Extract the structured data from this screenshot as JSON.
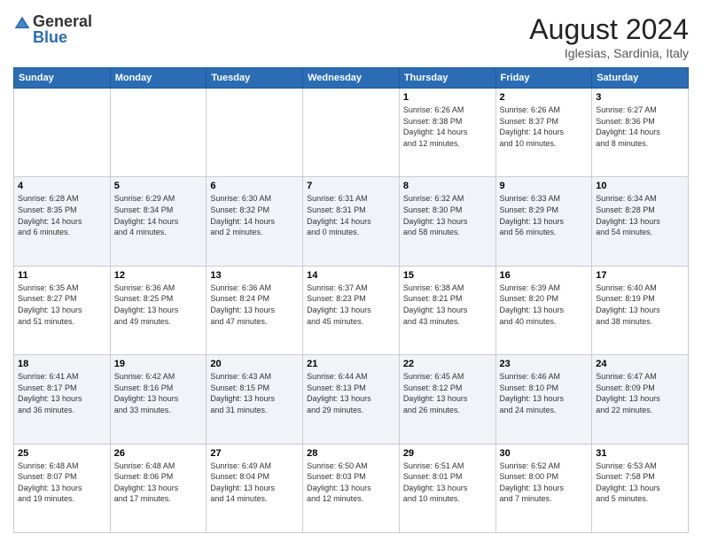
{
  "logo": {
    "general": "General",
    "blue": "Blue"
  },
  "header": {
    "month": "August 2024",
    "location": "Iglesias, Sardinia, Italy"
  },
  "weekdays": [
    "Sunday",
    "Monday",
    "Tuesday",
    "Wednesday",
    "Thursday",
    "Friday",
    "Saturday"
  ],
  "weeks": [
    [
      {
        "day": "",
        "info": ""
      },
      {
        "day": "",
        "info": ""
      },
      {
        "day": "",
        "info": ""
      },
      {
        "day": "",
        "info": ""
      },
      {
        "day": "1",
        "info": "Sunrise: 6:26 AM\nSunset: 8:38 PM\nDaylight: 14 hours\nand 12 minutes."
      },
      {
        "day": "2",
        "info": "Sunrise: 6:26 AM\nSunset: 8:37 PM\nDaylight: 14 hours\nand 10 minutes."
      },
      {
        "day": "3",
        "info": "Sunrise: 6:27 AM\nSunset: 8:36 PM\nDaylight: 14 hours\nand 8 minutes."
      }
    ],
    [
      {
        "day": "4",
        "info": "Sunrise: 6:28 AM\nSunset: 8:35 PM\nDaylight: 14 hours\nand 6 minutes."
      },
      {
        "day": "5",
        "info": "Sunrise: 6:29 AM\nSunset: 8:34 PM\nDaylight: 14 hours\nand 4 minutes."
      },
      {
        "day": "6",
        "info": "Sunrise: 6:30 AM\nSunset: 8:32 PM\nDaylight: 14 hours\nand 2 minutes."
      },
      {
        "day": "7",
        "info": "Sunrise: 6:31 AM\nSunset: 8:31 PM\nDaylight: 14 hours\nand 0 minutes."
      },
      {
        "day": "8",
        "info": "Sunrise: 6:32 AM\nSunset: 8:30 PM\nDaylight: 13 hours\nand 58 minutes."
      },
      {
        "day": "9",
        "info": "Sunrise: 6:33 AM\nSunset: 8:29 PM\nDaylight: 13 hours\nand 56 minutes."
      },
      {
        "day": "10",
        "info": "Sunrise: 6:34 AM\nSunset: 8:28 PM\nDaylight: 13 hours\nand 54 minutes."
      }
    ],
    [
      {
        "day": "11",
        "info": "Sunrise: 6:35 AM\nSunset: 8:27 PM\nDaylight: 13 hours\nand 51 minutes."
      },
      {
        "day": "12",
        "info": "Sunrise: 6:36 AM\nSunset: 8:25 PM\nDaylight: 13 hours\nand 49 minutes."
      },
      {
        "day": "13",
        "info": "Sunrise: 6:36 AM\nSunset: 8:24 PM\nDaylight: 13 hours\nand 47 minutes."
      },
      {
        "day": "14",
        "info": "Sunrise: 6:37 AM\nSunset: 8:23 PM\nDaylight: 13 hours\nand 45 minutes."
      },
      {
        "day": "15",
        "info": "Sunrise: 6:38 AM\nSunset: 8:21 PM\nDaylight: 13 hours\nand 43 minutes."
      },
      {
        "day": "16",
        "info": "Sunrise: 6:39 AM\nSunset: 8:20 PM\nDaylight: 13 hours\nand 40 minutes."
      },
      {
        "day": "17",
        "info": "Sunrise: 6:40 AM\nSunset: 8:19 PM\nDaylight: 13 hours\nand 38 minutes."
      }
    ],
    [
      {
        "day": "18",
        "info": "Sunrise: 6:41 AM\nSunset: 8:17 PM\nDaylight: 13 hours\nand 36 minutes."
      },
      {
        "day": "19",
        "info": "Sunrise: 6:42 AM\nSunset: 8:16 PM\nDaylight: 13 hours\nand 33 minutes."
      },
      {
        "day": "20",
        "info": "Sunrise: 6:43 AM\nSunset: 8:15 PM\nDaylight: 13 hours\nand 31 minutes."
      },
      {
        "day": "21",
        "info": "Sunrise: 6:44 AM\nSunset: 8:13 PM\nDaylight: 13 hours\nand 29 minutes."
      },
      {
        "day": "22",
        "info": "Sunrise: 6:45 AM\nSunset: 8:12 PM\nDaylight: 13 hours\nand 26 minutes."
      },
      {
        "day": "23",
        "info": "Sunrise: 6:46 AM\nSunset: 8:10 PM\nDaylight: 13 hours\nand 24 minutes."
      },
      {
        "day": "24",
        "info": "Sunrise: 6:47 AM\nSunset: 8:09 PM\nDaylight: 13 hours\nand 22 minutes."
      }
    ],
    [
      {
        "day": "25",
        "info": "Sunrise: 6:48 AM\nSunset: 8:07 PM\nDaylight: 13 hours\nand 19 minutes."
      },
      {
        "day": "26",
        "info": "Sunrise: 6:48 AM\nSunset: 8:06 PM\nDaylight: 13 hours\nand 17 minutes."
      },
      {
        "day": "27",
        "info": "Sunrise: 6:49 AM\nSunset: 8:04 PM\nDaylight: 13 hours\nand 14 minutes."
      },
      {
        "day": "28",
        "info": "Sunrise: 6:50 AM\nSunset: 8:03 PM\nDaylight: 13 hours\nand 12 minutes."
      },
      {
        "day": "29",
        "info": "Sunrise: 6:51 AM\nSunset: 8:01 PM\nDaylight: 13 hours\nand 10 minutes."
      },
      {
        "day": "30",
        "info": "Sunrise: 6:52 AM\nSunset: 8:00 PM\nDaylight: 13 hours\nand 7 minutes."
      },
      {
        "day": "31",
        "info": "Sunrise: 6:53 AM\nSunset: 7:58 PM\nDaylight: 13 hours\nand 5 minutes."
      }
    ]
  ]
}
